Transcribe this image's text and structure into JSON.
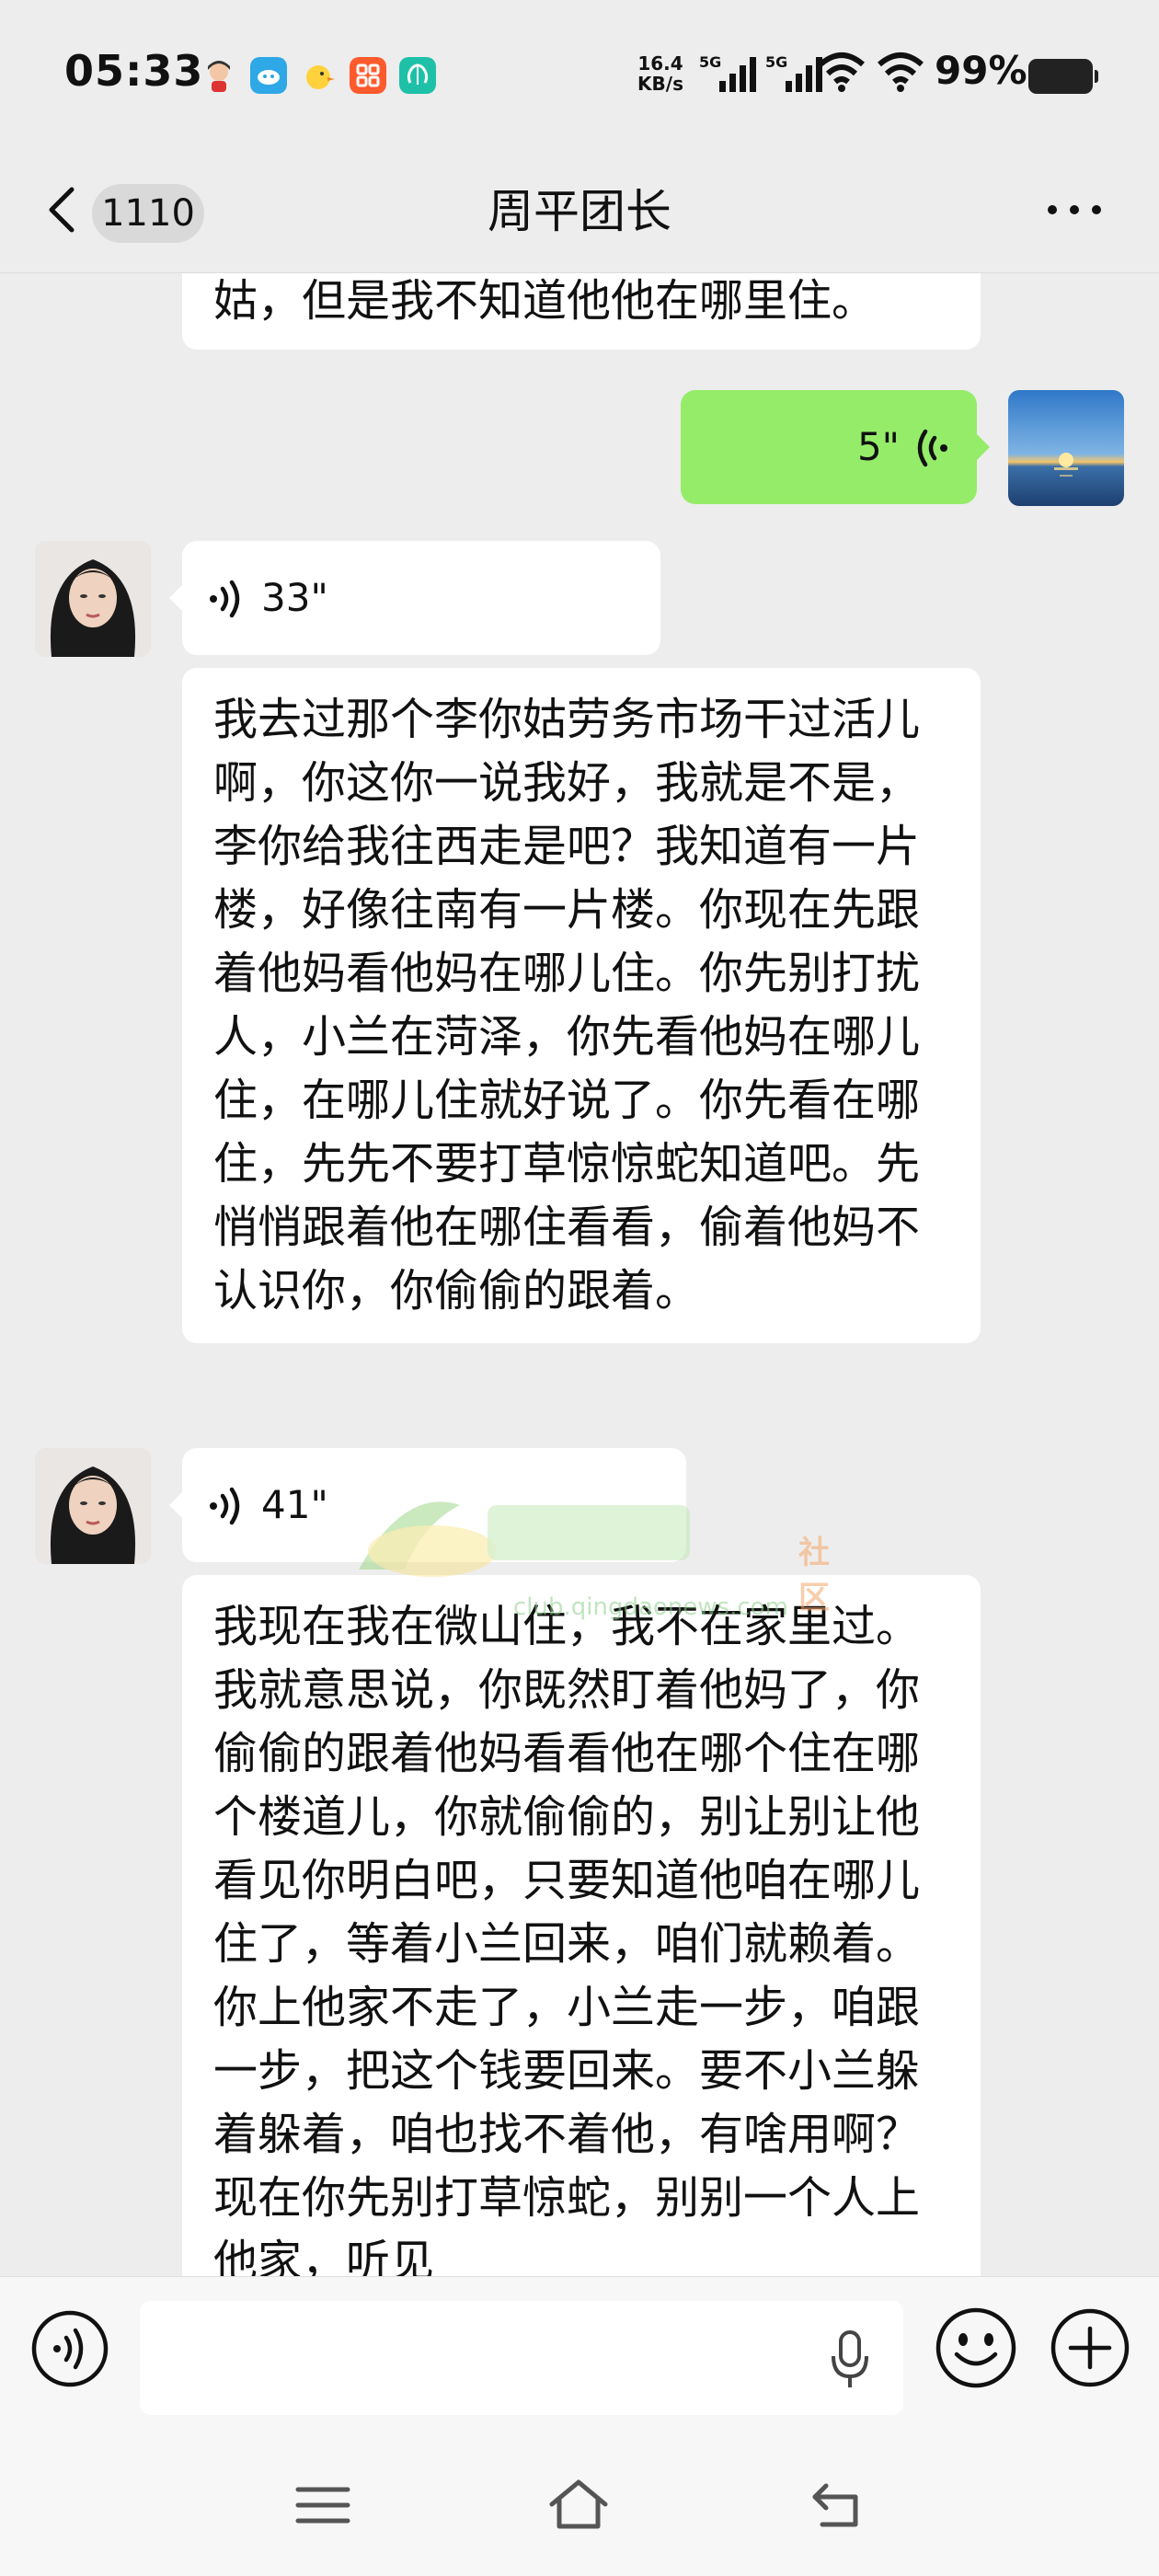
{
  "status_bar": {
    "time": "05:33",
    "net_speed_value": "16.4",
    "net_speed_unit": "KB/s",
    "sim1_label": "5G",
    "sim2_label": "5G",
    "battery_percent": "99%",
    "app_icons": [
      "avatar-app-icon",
      "cloud-app-icon",
      "chick-app-icon",
      "grid-app-icon",
      "brain-app-icon"
    ]
  },
  "header": {
    "unread_count": "1110",
    "title": "周平团长"
  },
  "messages": {
    "truncated_text": "姑，但是我不知道他他在哪里住。",
    "sent_voice_duration": "5\"",
    "voice1_duration": "33\"",
    "text1": "我去过那个李你姑劳务市场干过活儿啊，你这你一说我好，我就是不是，李你给我往西走是吧？我知道有一片楼，好像往南有一片楼。你现在先跟着他妈看他妈在哪儿住。你先别打扰人，小兰在菏泽，你先看他妈在哪儿住，在哪儿住就好说了。你先看在哪住，先先不要打草惊惊蛇知道吧。先悄悄跟着他在哪住看看，偷着他妈不认识你，你偷偷的跟着。",
    "voice2_duration": "41\"",
    "text2": "我现在我在微山住，我不在家里过。我就意思说，你既然盯着他妈了，你偷偷的跟着他妈看看他在哪个住在哪个楼道儿，你就偷偷的，别让别让他看见你明白吧，只要知道他咱在哪儿住了，等着小兰回来，咱们就赖着。你上他家不走了，小兰走一步，咱跟一步，把这个钱要回来。要不小兰躲着躲着，咱也找不着他，有啥用啊？现在你先别打草惊蛇，别别一个人上他家，听见"
  },
  "watermark": {
    "url": "club.qingdaonews.com",
    "tag": "社区"
  },
  "input": {
    "placeholder": ""
  },
  "colors": {
    "background": "#ededed",
    "sent_bubble": "#95ec69",
    "received_bubble": "#ffffff"
  }
}
